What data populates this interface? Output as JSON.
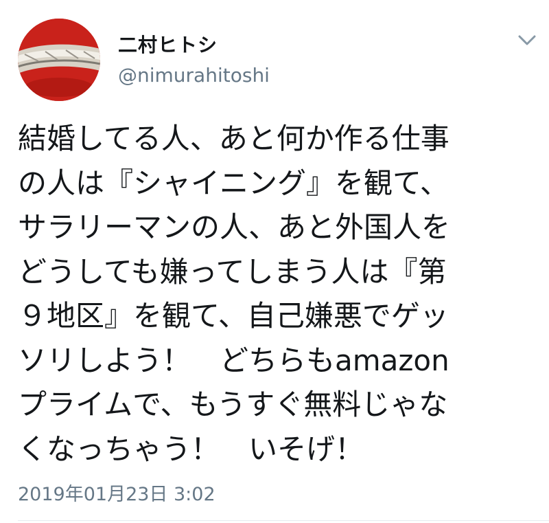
{
  "user": {
    "display_name": "二村ヒトシ",
    "handle": "@nimurahitoshi",
    "avatar_icon": "profile-photo"
  },
  "menu": {
    "icon": "chevron-down-icon"
  },
  "tweet": {
    "lines": [
      "結婚してる人、あと何か作る仕事",
      "の人は『シャイニング』を観て、",
      "サラリーマンの人、あと外国人を",
      "どうしても嫌ってしまう人は『第",
      "９地区』を観て、自己嫌悪でゲッ",
      "ソリしよう！　どちらもamazon",
      "プライムで、もうすぐ無料じゃな",
      "くなっちゃう！　いそげ！"
    ],
    "timestamp": "2019年01月23日 3:02"
  },
  "colors": {
    "text": "#14171a",
    "secondary": "#657786",
    "divider": "#e6ecf0"
  }
}
